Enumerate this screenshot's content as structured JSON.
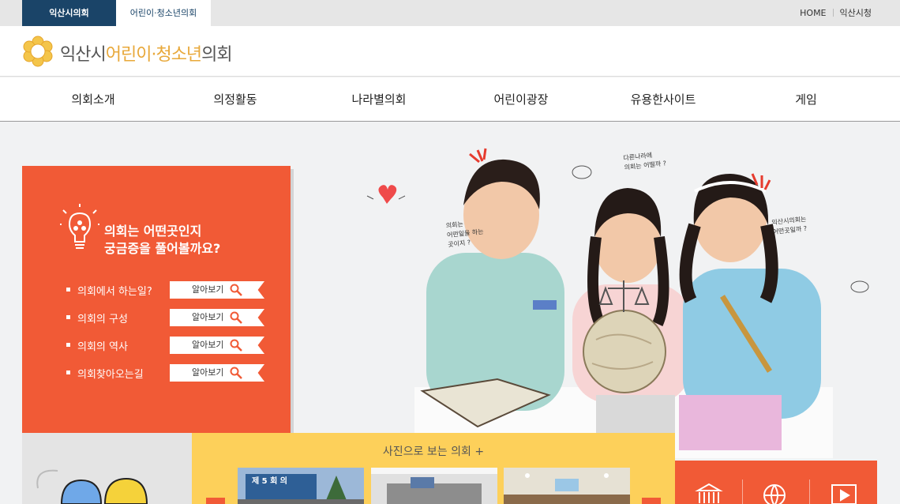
{
  "topbar": {
    "tab_council": "익산시의회",
    "tab_youth": "어린이·청소년의회",
    "util_home": "HOME",
    "util_city": "익산시청"
  },
  "header": {
    "logo_part1": "익산시",
    "logo_part2": "어린이·청소년",
    "logo_part3": "의회",
    "seal_text": "의회"
  },
  "nav": {
    "items": [
      "의회소개",
      "의정활동",
      "나라별의회",
      "어린이광장",
      "유용한사이트",
      "게임"
    ]
  },
  "info": {
    "title_line1": "의회는 어떤곳인지",
    "title_line2": "궁금증을 풀어볼까요?",
    "button_label": "알아보기",
    "questions": [
      "의회에서 하는일?",
      "의회의 구성",
      "의회의 역사",
      "의회찾아오는길"
    ]
  },
  "photos": {
    "title": "사진으로 보는 의회",
    "plus": "+",
    "thumb1_sign": "제 5 회 의"
  },
  "notes": {
    "note1": [
      "의회는",
      "어떤일을 하는",
      "곳이지 ?"
    ],
    "note2": [
      "다른나라에",
      "의회는 어떨까 ?"
    ],
    "note3": [
      "익산시의회는",
      "어떤곳일까 ?"
    ]
  },
  "colors": {
    "accent": "#f15a36",
    "navy": "#1a4468",
    "gold": "#e8a83a",
    "yellow": "#fdd05a"
  }
}
